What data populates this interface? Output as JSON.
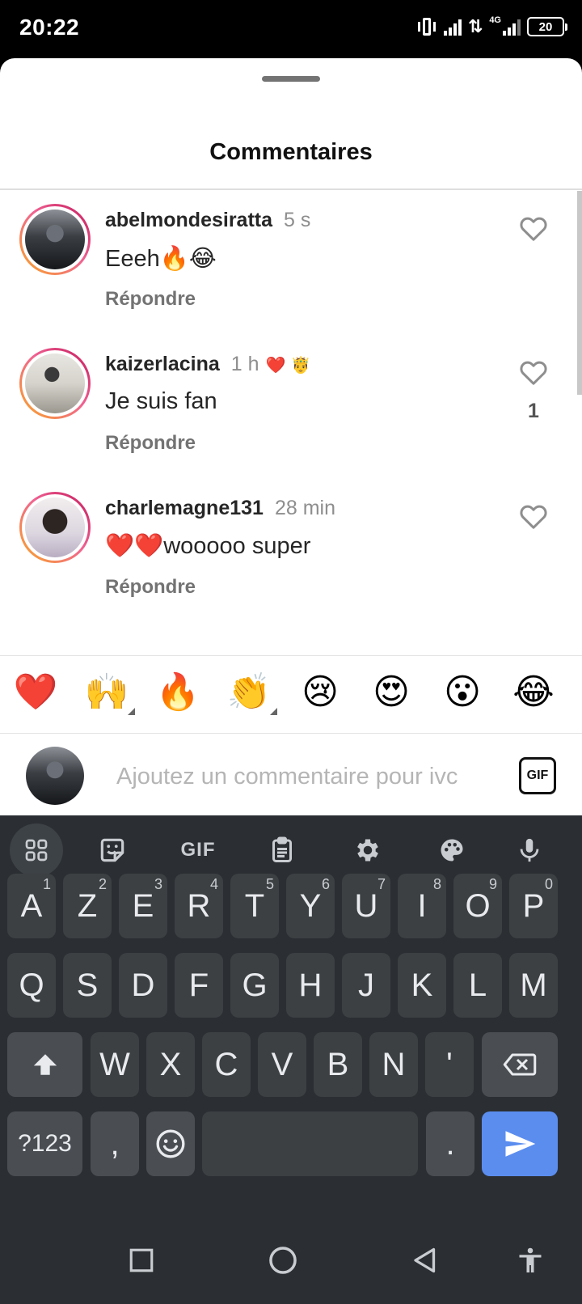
{
  "status_bar": {
    "time": "20:22",
    "network": "4G",
    "battery": "20"
  },
  "sheet": {
    "title": "Commentaires"
  },
  "comments": [
    {
      "username": "abelmondesiratta",
      "time": "5 s",
      "text": "Eeeh🔥😂",
      "reply_label": "Répondre",
      "likes": ""
    },
    {
      "username": "kaizerlacina",
      "time": "1 h",
      "badge": "❤️ 🤴",
      "text": "Je suis fan",
      "reply_label": "Répondre",
      "likes": "1"
    },
    {
      "username": "charlemagne131",
      "time": "28 min",
      "text": "❤️❤️wooooo super",
      "reply_label": "Répondre",
      "likes": ""
    }
  ],
  "emoji_bar": [
    "❤️",
    "🙌",
    "🔥",
    "👏",
    "😢",
    "😍",
    "😮",
    "😂"
  ],
  "composer": {
    "placeholder": "Ajoutez un commentaire pour ivc",
    "gif_label": "GIF"
  },
  "keyboard": {
    "toolbar": [
      "apps-icon",
      "sticker-icon",
      "GIF",
      "clipboard-icon",
      "settings-icon",
      "palette-icon",
      "mic-icon"
    ],
    "toolbar_gif_label": "GIF",
    "row1": [
      {
        "k": "A",
        "h": "1"
      },
      {
        "k": "Z",
        "h": "2"
      },
      {
        "k": "E",
        "h": "3"
      },
      {
        "k": "R",
        "h": "4"
      },
      {
        "k": "T",
        "h": "5"
      },
      {
        "k": "Y",
        "h": "6"
      },
      {
        "k": "U",
        "h": "7"
      },
      {
        "k": "I",
        "h": "8"
      },
      {
        "k": "O",
        "h": "9"
      },
      {
        "k": "P",
        "h": "0"
      }
    ],
    "row2": [
      "Q",
      "S",
      "D",
      "F",
      "G",
      "H",
      "J",
      "K",
      "L",
      "M"
    ],
    "row3": [
      "W",
      "X",
      "C",
      "V",
      "B",
      "N",
      "'"
    ],
    "symbols_label": "?123",
    "comma": ",",
    "period": "."
  },
  "colors": {
    "accent": "#5b8def",
    "like_red": "#ed4956",
    "keyboard_bg": "#2b2f33",
    "key_bg": "#3c4043"
  }
}
